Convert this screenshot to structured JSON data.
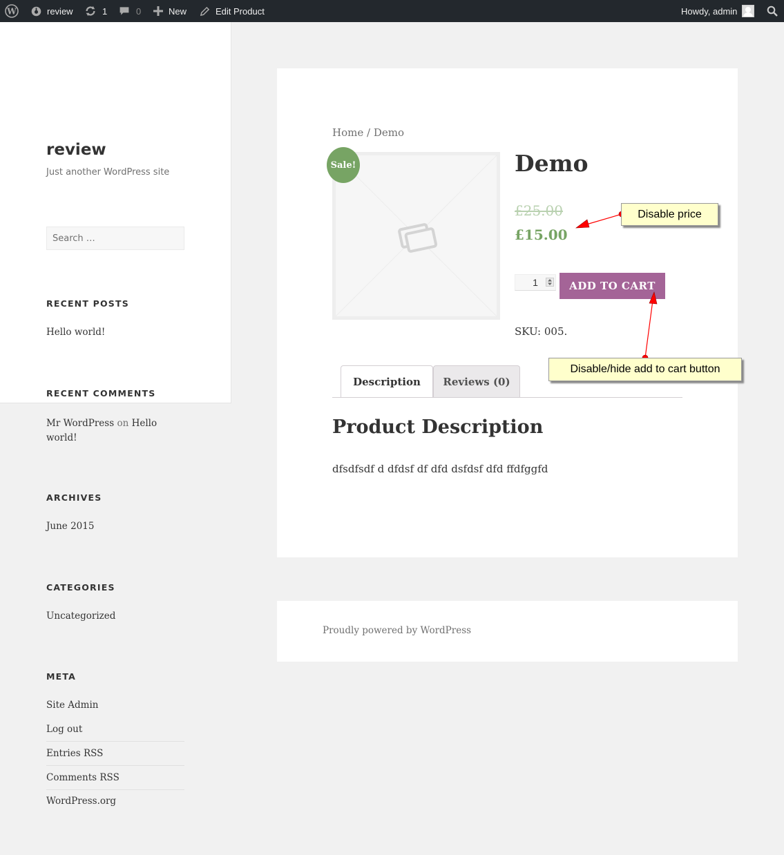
{
  "admin_bar": {
    "site_name": "review",
    "updates_count": "1",
    "comments_count": "0",
    "new_label": "New",
    "edit_label": "Edit Product",
    "greeting": "Howdy, admin"
  },
  "sidebar": {
    "site_title": "review",
    "site_description": "Just another WordPress site",
    "search_placeholder": "Search …",
    "recent_posts": {
      "title": "RECENT POSTS",
      "items": [
        "Hello world!"
      ]
    },
    "recent_comments": {
      "title": "RECENT COMMENTS",
      "author": "Mr WordPress",
      "on": "on",
      "post_line1": "Hello",
      "post_line2": "world!"
    },
    "archives": {
      "title": "ARCHIVES",
      "items": [
        "June 2015"
      ]
    },
    "categories": {
      "title": "CATEGORIES",
      "items": [
        "Uncategorized"
      ]
    },
    "meta": {
      "title": "META",
      "items": [
        "Site Admin",
        "Log out",
        "Entries RSS",
        "Comments RSS",
        "WordPress.org"
      ]
    }
  },
  "product": {
    "breadcrumb_home": "Home",
    "breadcrumb_sep": " / ",
    "breadcrumb_current": "Demo",
    "sale_badge": "Sale!",
    "title": "Demo",
    "price_old": "£25.00",
    "price_new": "£15.00",
    "quantity": "1",
    "add_to_cart": "ADD TO CART",
    "sku": "SKU: 005.",
    "tabs": [
      "Description",
      "Reviews (0)"
    ],
    "description_heading": "Product Description",
    "description_text": "dfsdfsdf d dfdsf df dfd dsfdsf dfd ffdfggfd"
  },
  "footer": {
    "text": "Proudly powered by WordPress"
  },
  "annotations": {
    "price_note": "Disable price",
    "cart_note": "Disable/hide add to cart button"
  },
  "colors": {
    "admin_bar": "#23282d",
    "sale_green": "#77a464",
    "button_purple": "#a46497",
    "callout_bg": "#ffffcc",
    "arrow_red": "#ff0000"
  },
  "icons": [
    "wordpress-logo-icon",
    "dashboard-icon",
    "updates-icon",
    "comment-icon",
    "plus-icon",
    "pencil-icon",
    "avatar-icon",
    "search-icon",
    "placeholder-image-icon"
  ]
}
